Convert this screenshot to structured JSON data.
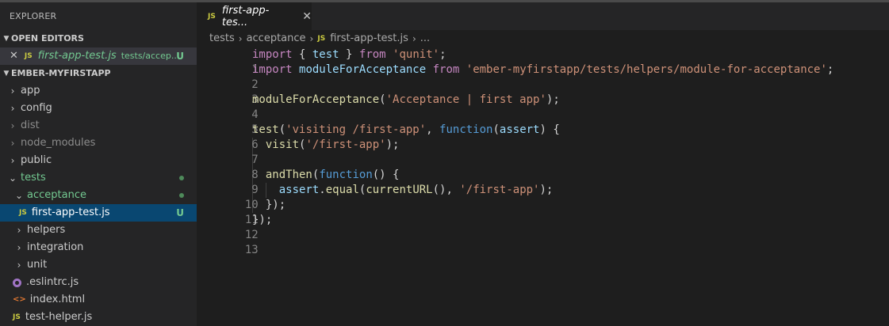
{
  "sidebar": {
    "title": "EXPLORER",
    "open_editors": {
      "header": "OPEN EDITORS",
      "file_name": "first-app-test.js",
      "file_path": "tests/accep...",
      "status": "U"
    },
    "project": {
      "header": "EMBER-MYFIRSTAPP",
      "items": [
        {
          "label": "app"
        },
        {
          "label": "config"
        },
        {
          "label": "dist"
        },
        {
          "label": "node_modules"
        },
        {
          "label": "public"
        },
        {
          "label": "tests"
        },
        {
          "label": "acceptance"
        },
        {
          "label": "first-app-test.js",
          "status": "U"
        },
        {
          "label": "helpers"
        },
        {
          "label": "integration"
        },
        {
          "label": "unit"
        },
        {
          "label": ".eslintrc.js"
        },
        {
          "label": "index.html"
        },
        {
          "label": "test-helper.js"
        }
      ]
    }
  },
  "editor": {
    "tab": {
      "label": "first-app-tes...",
      "icon": "JS"
    },
    "breadcrumb": [
      "tests",
      "acceptance",
      "first-app-test.js",
      "..."
    ],
    "line_numbers": [
      "1",
      "2",
      "3",
      "4",
      "5",
      "6",
      "7",
      "8",
      "9",
      "10",
      "11",
      "12",
      "13"
    ]
  },
  "colors": {
    "keyword": "#c586c0",
    "string": "#ce9178",
    "function": "#dcdcaa",
    "variable": "#9cdcfe",
    "selection": "#094771",
    "untracked": "#73c991"
  }
}
